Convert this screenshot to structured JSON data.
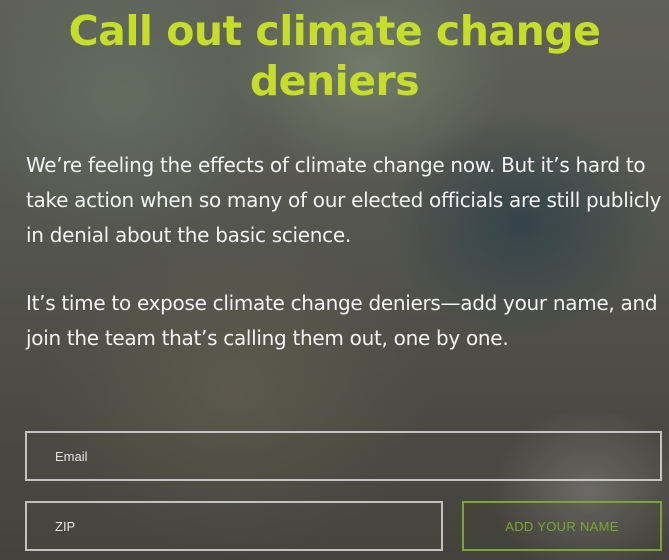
{
  "headline": {
    "line1": "Call out climate change",
    "line2": "deniers"
  },
  "body": {
    "paragraph1": "We’re feeling the effects of climate change now. But it’s hard to take action when so many of our elected officials are still publicly in denial about the basic science.",
    "paragraph2": "It’s time to expose climate change deniers—add your name, and join the team that’s calling them out, one by one."
  },
  "form": {
    "email_placeholder": "Email",
    "zip_placeholder": "ZIP",
    "submit_label": "ADD YOUR NAME"
  },
  "colors": {
    "headline": "#c5de2a",
    "button_accent": "#7ea437"
  }
}
